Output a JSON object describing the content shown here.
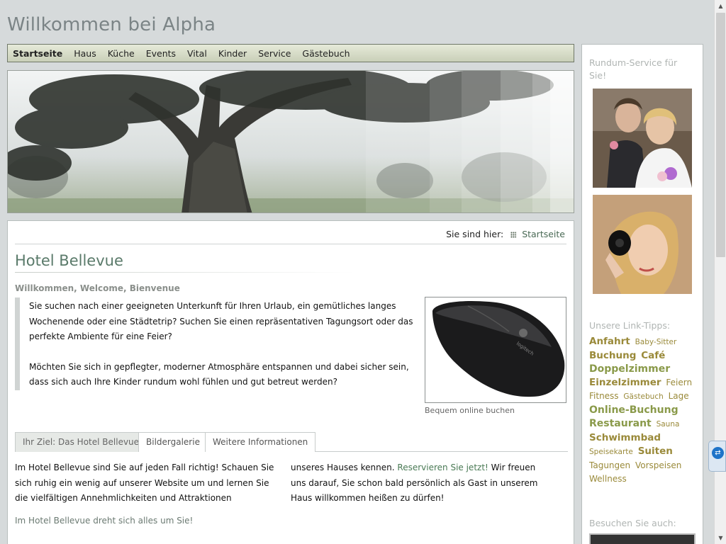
{
  "site": {
    "title": "Willkommen bei Alpha"
  },
  "nav": {
    "items": [
      "Startseite",
      "Haus",
      "Küche",
      "Events",
      "Vital",
      "Kinder",
      "Service",
      "Gästebuch"
    ]
  },
  "breadcrumb": {
    "prefix": "Sie sind hier:",
    "current": "Startseite"
  },
  "main": {
    "title": "Hotel Bellevue",
    "subtitle": "Willkommen, Welcome, Bienvenue",
    "intro": {
      "p1": "Sie suchen nach einer geeigneten Unterkunft für Ihren Urlaub, ein gemütliches langes Wochenende oder eine Städtetrip? Suchen Sie einen repräsentativen Tagungsort oder das perfekte Ambiente für eine Feier?",
      "p2": "Möchten Sie sich in gepflegter, moderner Atmosphäre entspannen und dabei sicher sein, dass sich auch Ihre Kinder rundum wohl fühlen und gut betreut werden?"
    },
    "image_caption": "Bequem online buchen",
    "tabs": [
      "Ihr Ziel: Das Hotel Bellevue",
      "Bildergalerie",
      "Weitere Informationen"
    ],
    "col1": "Im Hotel Bellevue sind Sie auf jeden Fall richtig! Schauen Sie sich ruhig ein wenig auf unserer Website um und lernen Sie die vielfältigen Annehmlichkeiten und Attraktionen",
    "col2_pre": "unseres Hauses kennen.",
    "col2_link": "Reservieren Sie jetzt!",
    "col2_post": "Wir freuen uns darauf, Sie schon bald persönlich als Gast in unserem Haus willkommen heißen zu dürfen!",
    "tagline": "Im Hotel Bellevue dreht sich alles um Sie!"
  },
  "sidebar": {
    "heading1": "Rundum-Service für Sie!",
    "heading2": "Unsere Link-Tipps:",
    "heading3": "Besuchen Sie auch:",
    "tags": [
      {
        "label": "Anfahrt",
        "size": "s3"
      },
      {
        "label": "Baby-Sitter",
        "size": "s1"
      },
      {
        "label": "Buchung",
        "size": "s3"
      },
      {
        "label": "Café",
        "size": "s3"
      },
      {
        "label": "Doppelzimmer",
        "size": "s4"
      },
      {
        "label": "Einzelzimmer",
        "size": "s3"
      },
      {
        "label": "Feiern",
        "size": "s2"
      },
      {
        "label": "Fitness",
        "size": "s2"
      },
      {
        "label": "Gästebuch",
        "size": "s1"
      },
      {
        "label": "Lage",
        "size": "s2"
      },
      {
        "label": "Online-Buchung",
        "size": "s4"
      },
      {
        "label": "Restaurant",
        "size": "s4"
      },
      {
        "label": "Sauna",
        "size": "s1"
      },
      {
        "label": "Schwimmbad",
        "size": "s3"
      },
      {
        "label": "Speisekarte",
        "size": "s1"
      },
      {
        "label": "Suiten",
        "size": "s3"
      },
      {
        "label": "Tagungen",
        "size": "s2"
      },
      {
        "label": "Vorspeisen",
        "size": "s2"
      },
      {
        "label": "Wellness",
        "size": "s2"
      }
    ]
  },
  "colors": {
    "accent": "#5a7a6a",
    "tag": "#9a8a3a",
    "link": "#4a7a55"
  }
}
